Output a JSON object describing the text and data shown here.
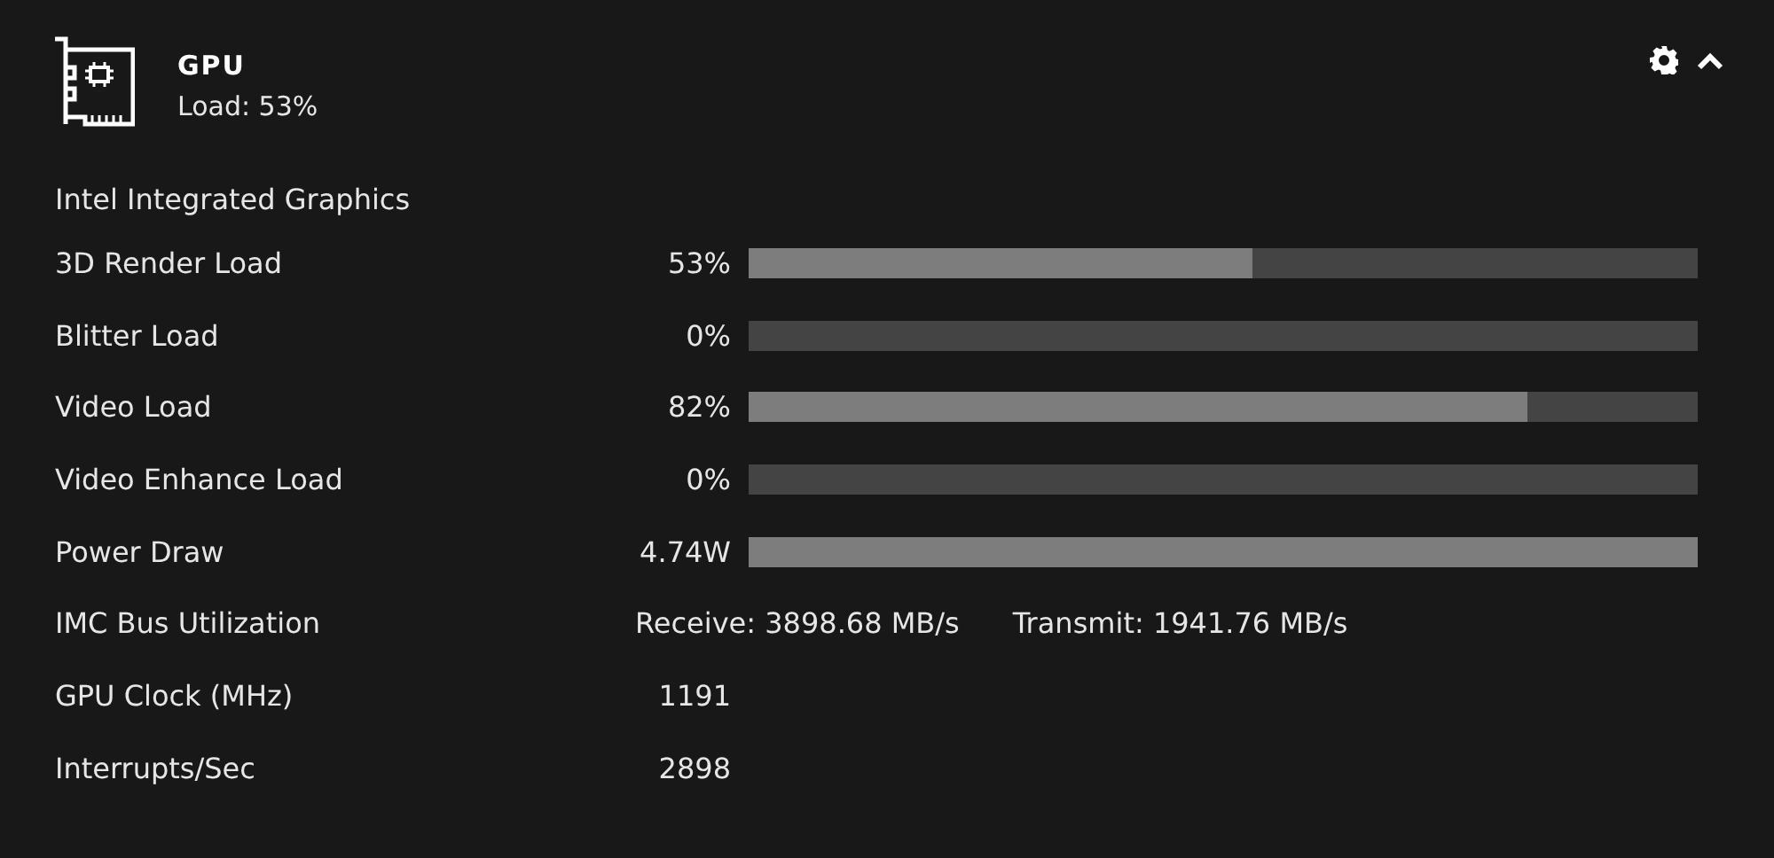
{
  "header": {
    "title": "GPU",
    "subtitle": "Load: 53%",
    "expanded": true
  },
  "section_title": "Intel Integrated Graphics",
  "metrics": [
    {
      "kind": "bar",
      "label": "3D Render Load",
      "reading": "53%",
      "level": 0.53
    },
    {
      "kind": "bar",
      "label": "Blitter Load",
      "reading": "0%",
      "level": 0
    },
    {
      "kind": "bar",
      "label": "Video Load",
      "reading": "82%",
      "level": 0.82
    },
    {
      "kind": "bar",
      "label": "Video Enhance Load",
      "reading": "0%",
      "level": 0
    },
    {
      "kind": "bar",
      "label": "Power Draw",
      "reading": "4.74W",
      "level": 1
    },
    {
      "kind": "pair",
      "label": "IMC Bus Utilization",
      "receive": "Receive: 3898.68 MB/s",
      "transmit": "Transmit: 1941.76 MB/s"
    },
    {
      "kind": "value",
      "label": "GPU Clock (MHz)",
      "reading": "1191"
    },
    {
      "kind": "value",
      "label": "Interrupts/Sec",
      "reading": "2898"
    }
  ]
}
